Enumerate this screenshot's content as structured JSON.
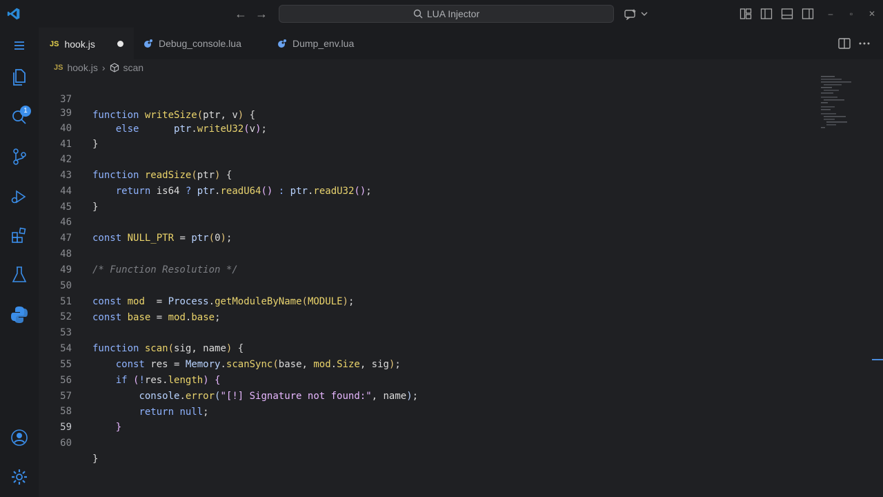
{
  "titlebar": {
    "search_text": "LUA Injector"
  },
  "activity": {
    "badge_count": "1"
  },
  "tabs": [
    {
      "label": "hook.js",
      "type": "JS",
      "active": true,
      "modified": true
    },
    {
      "label": "Debug_console.lua",
      "type": "lua",
      "active": false
    },
    {
      "label": "Dump_env.lua",
      "type": "lua",
      "active": false
    }
  ],
  "breadcrumb": {
    "file": "hook.js",
    "symbol": "scan"
  },
  "editor": {
    "lines": [
      {
        "n": "37",
        "code": "function writeSize(ptr, v) {"
      },
      {
        "n": "39",
        "code": "    else      ptr.writeU32(v);"
      },
      {
        "n": "40",
        "code": "}"
      },
      {
        "n": "41",
        "code": ""
      },
      {
        "n": "42",
        "code": "function readSize(ptr) {"
      },
      {
        "n": "43",
        "code": "    return is64 ? ptr.readU64() : ptr.readU32();"
      },
      {
        "n": "44",
        "code": "}"
      },
      {
        "n": "45",
        "code": ""
      },
      {
        "n": "46",
        "code": "const NULL_PTR = ptr(0);"
      },
      {
        "n": "47",
        "code": ""
      },
      {
        "n": "48",
        "code": "/* Function Resolution */"
      },
      {
        "n": "49",
        "code": ""
      },
      {
        "n": "50",
        "code": "const mod  = Process.getModuleByName(MODULE);"
      },
      {
        "n": "51",
        "code": "const base = mod.base;"
      },
      {
        "n": "52",
        "code": ""
      },
      {
        "n": "53",
        "code": "function scan(sig, name) {"
      },
      {
        "n": "54",
        "code": "    const res = Memory.scanSync(base, mod.Size, sig);"
      },
      {
        "n": "55",
        "code": "    if (!res.length) {"
      },
      {
        "n": "56",
        "code": "        console.error(\"[!] Signature not found:\", name);"
      },
      {
        "n": "57",
        "code": "        return null;"
      },
      {
        "n": "58",
        "code": "    }"
      },
      {
        "n": "59",
        "code": ""
      },
      {
        "n": "60",
        "code": "}"
      }
    ]
  },
  "colors": {
    "background": "#1f2023",
    "keyword": "#8fb3ff",
    "function": "#ecd56b",
    "string": "#e7b7ff",
    "comment": "#7d7f84",
    "accent": "#3b8eea"
  }
}
